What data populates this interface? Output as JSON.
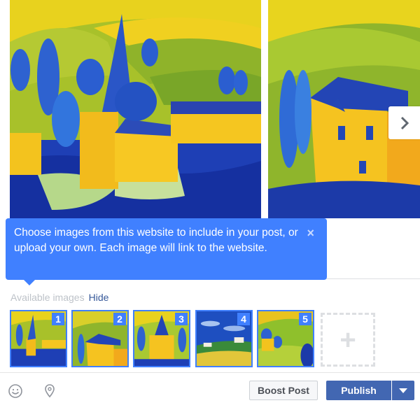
{
  "carousel": {
    "slides": [
      {
        "label": "Painting of village with church and blue trees"
      },
      {
        "label": "Painting of yellow houses with blue roofs"
      }
    ],
    "next_icon": "chevron-right-icon"
  },
  "tooltip": {
    "text": "Choose images from this website to include in your post, or upload your own. Each image will link to the website.",
    "close_glyph": "×",
    "close_icon": "close-icon"
  },
  "available": {
    "label": "Available images",
    "hide_label": "Hide"
  },
  "thumbnails": [
    {
      "badge": "1"
    },
    {
      "badge": "2"
    },
    {
      "badge": "3"
    },
    {
      "badge": "4"
    },
    {
      "badge": "5"
    }
  ],
  "add_image": {
    "glyph": "+",
    "icon": "plus-icon"
  },
  "footer": {
    "icons": [
      "smiley-icon",
      "location-pin-icon"
    ],
    "boost_label": "Boost Post",
    "publish_label": "Publish"
  },
  "colors": {
    "tooltip_bg": "#4080ff",
    "publish_bg": "#4267b2",
    "link": "#365899",
    "muted": "#bec3c9"
  }
}
